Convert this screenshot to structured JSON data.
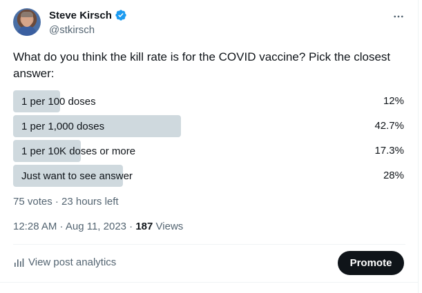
{
  "author": {
    "name": "Steve Kirsch",
    "handle": "@stkirsch"
  },
  "post": {
    "text": "What do you think the kill rate is for the COVID vaccine? Pick the closest answer:"
  },
  "poll": {
    "options": [
      {
        "label": "1 per 100 doses",
        "percent": "12%",
        "share": 0.12
      },
      {
        "label": "1 per 1,000 doses",
        "percent": "42.7%",
        "share": 0.427
      },
      {
        "label": "1 per 10K doses or more",
        "percent": "17.3%",
        "share": 0.173
      },
      {
        "label": "Just want to see answer",
        "percent": "28%",
        "share": 0.28
      }
    ],
    "summary": "75 votes · 23 hours left"
  },
  "timestamp": {
    "datetime": "12:28 AM · Aug 11, 2023 · ",
    "views_count": "187",
    "views_label": " Views"
  },
  "actions": {
    "analytics_label": "View post analytics",
    "promote_label": "Promote"
  },
  "colors": {
    "bar": "#cfd9de",
    "verified": "#1d9bf0",
    "promote_bg": "#0f1419"
  },
  "icons": {
    "more": "more-horizontal-icon",
    "verified": "verified-badge-icon",
    "analytics": "bar-chart-icon"
  }
}
